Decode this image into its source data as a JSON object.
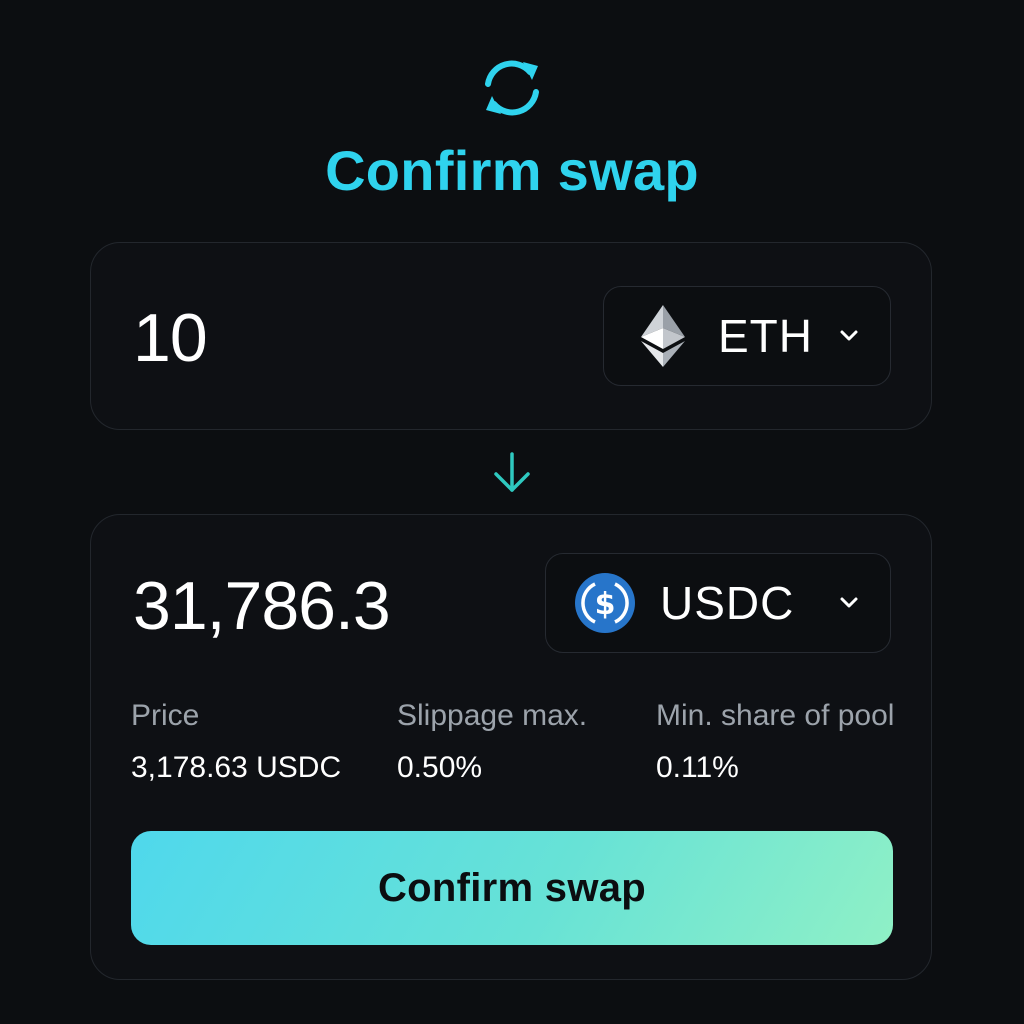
{
  "header": {
    "icon": "refresh-swap-icon",
    "title": "Confirm swap",
    "accent_color": "#2fd3ee"
  },
  "from": {
    "amount": "10",
    "token": {
      "symbol": "ETH",
      "icon": "ethereum-icon"
    }
  },
  "direction_icon": "arrow-down-icon",
  "to": {
    "amount": "31,786.3",
    "token": {
      "symbol": "USDC",
      "icon": "usdc-icon",
      "color": "#2775ca"
    }
  },
  "details": [
    {
      "label": "Price",
      "value": "3,178.63 USDC"
    },
    {
      "label": "Slippage max.",
      "value": "0.50%"
    },
    {
      "label": "Min. share of pool",
      "value": "0.11%"
    }
  ],
  "confirm_button": {
    "label": "Confirm swap",
    "gradient": [
      "#4fd8ec",
      "#8ff0c6"
    ]
  }
}
